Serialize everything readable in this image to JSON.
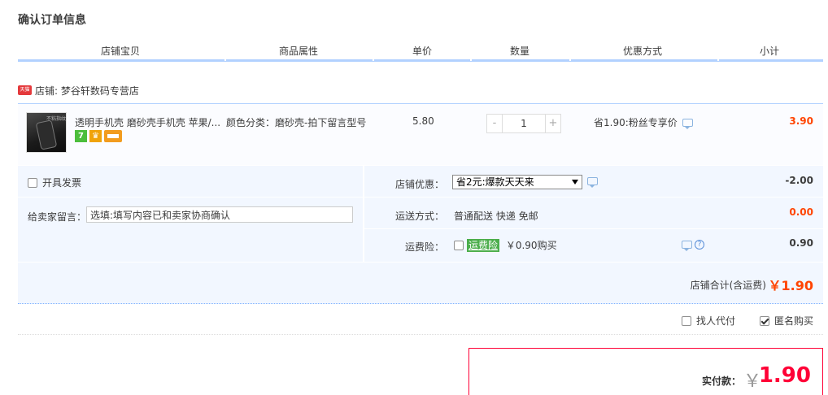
{
  "page": {
    "title": "确认订单信息"
  },
  "columns": [
    "店铺宝贝",
    "商品属性",
    "单价",
    "数量",
    "优惠方式",
    "小计"
  ],
  "shop": {
    "badge": "天猫",
    "label": "店铺: 梦谷轩数码专营店"
  },
  "item": {
    "thumb_caption": "不粘指纹",
    "title": "透明手机壳 磨砂壳手机壳 苹果/...",
    "attribute": "颜色分类：磨砂壳-拍下留言型号",
    "price": "5.80",
    "quantity": "1",
    "qty_minus": "-",
    "qty_plus": "+",
    "discount": "省1.90:粉丝专享价",
    "subtotal": "3.90",
    "service_icons": [
      "seven-day-return-icon",
      "guarantee-icon",
      "credit-card-icon"
    ],
    "svc_seven": "7"
  },
  "options": {
    "invoice_label": "开具发票",
    "memo_label": "给卖家留言：",
    "memo_placeholder": "选填:填写内容已和卖家协商确认",
    "coupon_label": "店铺优惠：",
    "coupon_selected": "省2元:爆款天天来",
    "coupon_amount": "-2.00",
    "shipping_label": "运送方式：",
    "shipping_value": "普通配送 快递 免邮",
    "shipping_amount": "0.00",
    "insurance_label": "运费险：",
    "insurance_tag": "运费险",
    "insurance_price": "￥0.90购买",
    "insurance_amount": "0.90",
    "help_glyph": "?"
  },
  "shop_total": {
    "label": "店铺合计(含运费)",
    "amount": "￥1.90"
  },
  "pay_options": {
    "proxy_label": "找人代付",
    "anonymous_label": "匿名购买",
    "proxy_checked": false,
    "anonymous_checked": true
  },
  "final": {
    "label": "实付款：",
    "yen": "￥",
    "amount": "1.90"
  },
  "colors": {
    "accent_red": "#ff0036",
    "price_red": "#ff4400",
    "header_blue": "#b2d1ff",
    "panel_bg": "#f2f7ff"
  }
}
